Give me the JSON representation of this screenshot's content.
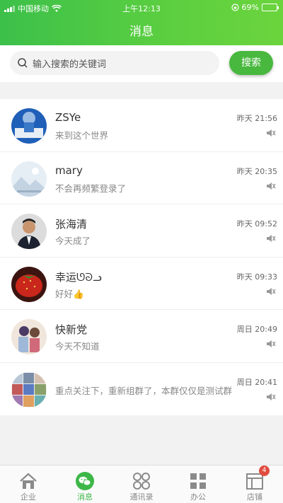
{
  "status_bar": {
    "carrier": "中国移动",
    "time": "上午12:13",
    "battery": "69%",
    "battery_level": 0.69
  },
  "header": {
    "title": "消息"
  },
  "search": {
    "placeholder": "输入搜索的关键词",
    "button_label": "搜索"
  },
  "conversations": [
    {
      "name": "ZSYe",
      "preview": "来到这个世界",
      "time": "昨天 21:56",
      "muted": true
    },
    {
      "name": "mary",
      "preview": "不会再频繁登录了",
      "time": "昨天 20:35",
      "muted": true
    },
    {
      "name": "张海清",
      "preview": "今天成了",
      "time": "昨天 09:52",
      "muted": true
    },
    {
      "name": "幸运ᘎᘐᓗ",
      "preview": "好好👍",
      "time": "昨天 09:33",
      "muted": true
    },
    {
      "name": "快新党",
      "preview": "今天不知道",
      "time": "周日 20:49",
      "muted": true
    },
    {
      "name": "",
      "preview": "重点关注下，重新组群了，本群仅仅是测试群",
      "time": "周日 20:41",
      "muted": true
    }
  ],
  "tabs": [
    {
      "label": "企业",
      "icon": "house-icon",
      "active": false
    },
    {
      "label": "消息",
      "icon": "chat-icon",
      "active": true
    },
    {
      "label": "通讯录",
      "icon": "contacts-icon",
      "active": false
    },
    {
      "label": "办公",
      "icon": "grid-icon",
      "active": false
    },
    {
      "label": "店铺",
      "icon": "store-icon",
      "active": false,
      "badge": "4"
    }
  ],
  "colors": {
    "primary": "#3db748",
    "badge": "#e04c3f"
  }
}
